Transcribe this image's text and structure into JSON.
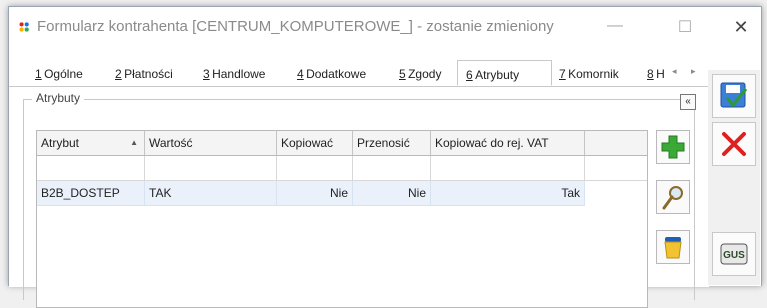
{
  "window": {
    "title": "Formularz kontrahenta [CENTRUM_KOMPUTEROWE_] - zostanie zmieniony",
    "minimize": "—",
    "maximize": "☐",
    "close": "✕"
  },
  "tabs": [
    {
      "num": "1",
      "label": "Ogólne"
    },
    {
      "num": "2",
      "label": "Płatności"
    },
    {
      "num": "3",
      "label": "Handlowe"
    },
    {
      "num": "4",
      "label": "Dodatkowe"
    },
    {
      "num": "5",
      "label": "Zgody"
    },
    {
      "num": "6",
      "label": "Atrybuty",
      "active": true
    },
    {
      "num": "7",
      "label": "Komornik"
    },
    {
      "num": "8",
      "label": "H"
    }
  ],
  "tab_scroll": "◂ ▸",
  "group": {
    "legend": "Atrybuty",
    "collapse": "«"
  },
  "grid": {
    "columns": [
      "Atrybut",
      "Wartość",
      "Kopiować",
      "Przenosić",
      "Kopiować do rej. VAT"
    ],
    "sort_indicator": "▲",
    "rows": [
      [
        "B2B_DOSTEP",
        "TAK",
        "Nie",
        "Nie",
        "Tak"
      ]
    ]
  },
  "icons": {
    "add": "plus-icon",
    "edit": "magnifier-icon",
    "delete": "trash-icon",
    "save": "save-icon",
    "cancel": "cancel-icon",
    "gus": "gus-icon"
  },
  "gus_label": "GUS",
  "colors": {
    "add_green": "#3aa935",
    "cancel_red": "#e02020",
    "selected_row": "#eaf1fb"
  }
}
